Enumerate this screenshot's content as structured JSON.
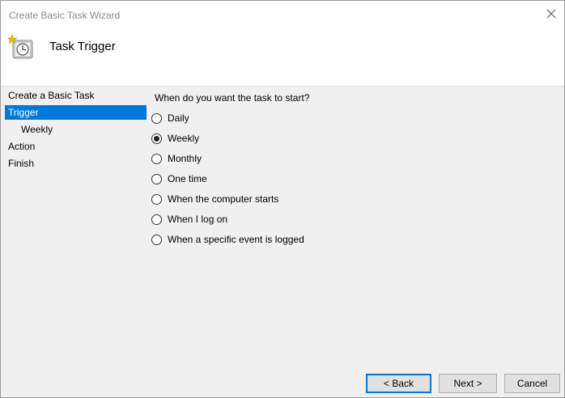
{
  "window": {
    "title": "Create Basic Task Wizard",
    "heading": "Task Trigger"
  },
  "sidebar": {
    "items": [
      {
        "label": "Create a Basic Task"
      },
      {
        "label": "Trigger"
      },
      {
        "label": "Weekly"
      },
      {
        "label": "Action"
      },
      {
        "label": "Finish"
      }
    ],
    "selected": "Trigger"
  },
  "main": {
    "question": "When do you want the task to start?",
    "options": [
      {
        "label": "Daily",
        "checked": false
      },
      {
        "label": "Weekly",
        "checked": true
      },
      {
        "label": "Monthly",
        "checked": false
      },
      {
        "label": "One time",
        "checked": false
      },
      {
        "label": "When the computer starts",
        "checked": false
      },
      {
        "label": "When I log on",
        "checked": false
      },
      {
        "label": "When a specific event is logged",
        "checked": false
      }
    ]
  },
  "buttons": {
    "back": "< Back",
    "next": "Next >",
    "cancel": "Cancel"
  },
  "colors": {
    "selection": "#0078d7",
    "window_bg": "#f0f0f0"
  }
}
